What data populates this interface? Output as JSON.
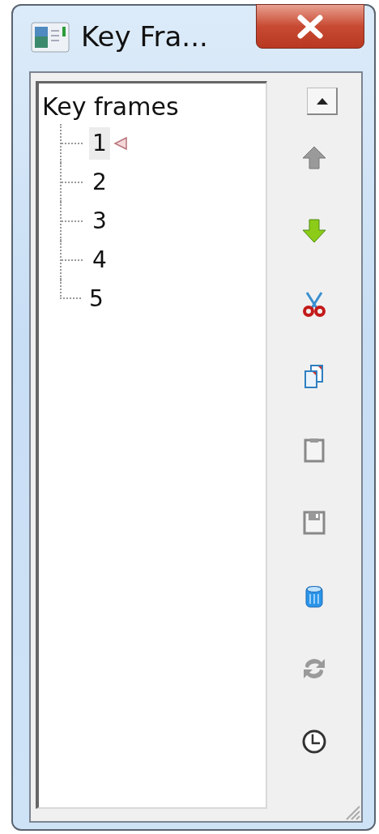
{
  "window": {
    "title": "Key Fra..."
  },
  "tree": {
    "label": "Key frames",
    "children": [
      {
        "label": "1",
        "selected": true,
        "marked": true
      },
      {
        "label": "2",
        "selected": false,
        "marked": false
      },
      {
        "label": "3",
        "selected": false,
        "marked": false
      },
      {
        "label": "4",
        "selected": false,
        "marked": false
      },
      {
        "label": "5",
        "selected": false,
        "marked": false
      }
    ]
  },
  "toolbar": [
    {
      "kind": "move-up",
      "disabled": true
    },
    {
      "kind": "move-down",
      "disabled": false
    },
    {
      "kind": "cut",
      "disabled": false
    },
    {
      "kind": "copy",
      "disabled": false
    },
    {
      "kind": "paste",
      "disabled": true
    },
    {
      "kind": "save",
      "disabled": true
    },
    {
      "kind": "delete",
      "disabled": false
    },
    {
      "kind": "refresh",
      "disabled": true
    },
    {
      "kind": "clock",
      "disabled": false
    }
  ]
}
